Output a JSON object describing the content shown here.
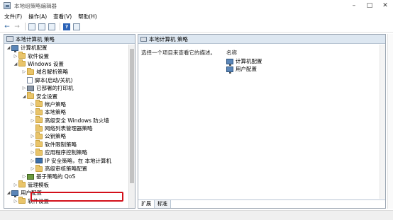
{
  "window": {
    "title": "本地组策略编辑器"
  },
  "menu": {
    "file": "文件(F)",
    "action": "操作(A)",
    "view": "查看(V)",
    "help": "帮助(H)"
  },
  "tree": {
    "root": "本地计算机 策略",
    "computer_config": "计算机配置",
    "software_settings": "软件设置",
    "windows_settings": "Windows 设置",
    "name_resolution": "域名解析策略",
    "scripts": "脚本(启动/关机)",
    "deployed_printers": "已部署的打印机",
    "security_settings": "安全设置",
    "account_policies": "帐户策略",
    "local_policies": "本地策略",
    "firewall": "高级安全 Windows 防火墙",
    "network_list": "网络列表管理器策略",
    "public_key": "公钥策略",
    "software_restriction": "软件限制策略",
    "app_control": "应用程序控制策略",
    "ip_security": "IP 安全策略，在 本地计算机",
    "audit_policy": "高级审核策略配置",
    "qos": "基于策略的 QoS",
    "admin_templates": "管理模板",
    "user_config": "用户配置",
    "user_software": "软件设置"
  },
  "right": {
    "header": "本地计算机 策略",
    "description": "选择一个项目来查看它的描述。",
    "column_name": "名称",
    "items": [
      "计算机配置",
      "用户配置"
    ],
    "tab_extended": "扩展",
    "tab_standard": "标准"
  }
}
